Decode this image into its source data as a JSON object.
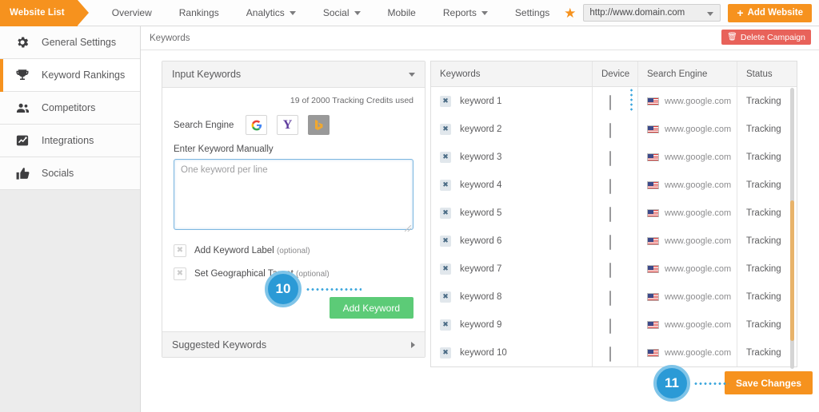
{
  "topnav": {
    "website_list_tab": "Website List",
    "items": [
      {
        "label": "Overview",
        "has_caret": false
      },
      {
        "label": "Rankings",
        "has_caret": false
      },
      {
        "label": "Analytics",
        "has_caret": true
      },
      {
        "label": "Social",
        "has_caret": true
      },
      {
        "label": "Mobile",
        "has_caret": false
      },
      {
        "label": "Reports",
        "has_caret": true
      },
      {
        "label": "Settings",
        "has_caret": false
      }
    ],
    "star_icon": "star-icon",
    "url_value": "http://www.domain.com",
    "add_website_label": "Add Website",
    "accent_color": "#f6921e"
  },
  "sidebar": {
    "items": [
      {
        "label": "General Settings",
        "icon": "gear-icon",
        "active": false
      },
      {
        "label": "Keyword Rankings",
        "icon": "trophy-icon",
        "active": true
      },
      {
        "label": "Competitors",
        "icon": "users-icon",
        "active": false
      },
      {
        "label": "Integrations",
        "icon": "chart-icon",
        "active": false
      },
      {
        "label": "Socials",
        "icon": "thumbs-up-icon",
        "active": false
      }
    ]
  },
  "breadcrumb": {
    "text": "Keywords"
  },
  "delete_campaign": {
    "label": "Delete Campaign",
    "icon": "trash-icon",
    "color": "#e8625a"
  },
  "input_panel": {
    "title": "Input Keywords",
    "credits_text": "19 of 2000 Tracking Credits used",
    "credits_used": 19,
    "credits_total": 2000,
    "search_engine_label": "Search Engine",
    "engines": [
      {
        "name": "google",
        "glyph": "G",
        "selected": false
      },
      {
        "name": "yahoo",
        "glyph": "Y",
        "selected": false
      },
      {
        "name": "bing",
        "glyph": "▶",
        "selected": true
      }
    ],
    "manual_label": "Enter Keyword Manually",
    "textarea_placeholder": "One keyword per line",
    "textarea_value": "",
    "checkboxes": [
      {
        "label": "Add Keyword Label",
        "optional": "(optional)",
        "checked": false
      },
      {
        "label": "Set Geographical Target",
        "optional": "(optional)",
        "checked": false
      }
    ],
    "add_keyword_label": "Add Keyword",
    "suggested_title": "Suggested Keywords"
  },
  "steps": [
    {
      "number": "10"
    },
    {
      "number": "11"
    }
  ],
  "keywords_table": {
    "columns": [
      "Keywords",
      "Device",
      "Search Engine",
      "Status"
    ],
    "rows": [
      {
        "keyword": "keyword 1",
        "device": "desktop-icon",
        "engine": "www.google.com",
        "flag": "us-flag",
        "status": "Tracking"
      },
      {
        "keyword": "keyword 2",
        "device": "desktop-icon",
        "engine": "www.google.com",
        "flag": "us-flag",
        "status": "Tracking"
      },
      {
        "keyword": "keyword 3",
        "device": "desktop-icon",
        "engine": "www.google.com",
        "flag": "us-flag",
        "status": "Tracking"
      },
      {
        "keyword": "keyword 4",
        "device": "desktop-icon",
        "engine": "www.google.com",
        "flag": "us-flag",
        "status": "Tracking"
      },
      {
        "keyword": "keyword 5",
        "device": "desktop-icon",
        "engine": "www.google.com",
        "flag": "us-flag",
        "status": "Tracking"
      },
      {
        "keyword": "keyword 6",
        "device": "desktop-icon",
        "engine": "www.google.com",
        "flag": "us-flag",
        "status": "Tracking"
      },
      {
        "keyword": "keyword 7",
        "device": "desktop-icon",
        "engine": "www.google.com",
        "flag": "us-flag",
        "status": "Tracking"
      },
      {
        "keyword": "keyword 8",
        "device": "desktop-icon",
        "engine": "www.google.com",
        "flag": "us-flag",
        "status": "Tracking"
      },
      {
        "keyword": "keyword 9",
        "device": "desktop-icon",
        "engine": "www.google.com",
        "flag": "us-flag",
        "status": "Tracking"
      },
      {
        "keyword": "keyword 10",
        "device": "desktop-icon",
        "engine": "www.google.com",
        "flag": "us-flag",
        "status": "Tracking"
      }
    ]
  },
  "save_changes": {
    "label": "Save Changes"
  }
}
